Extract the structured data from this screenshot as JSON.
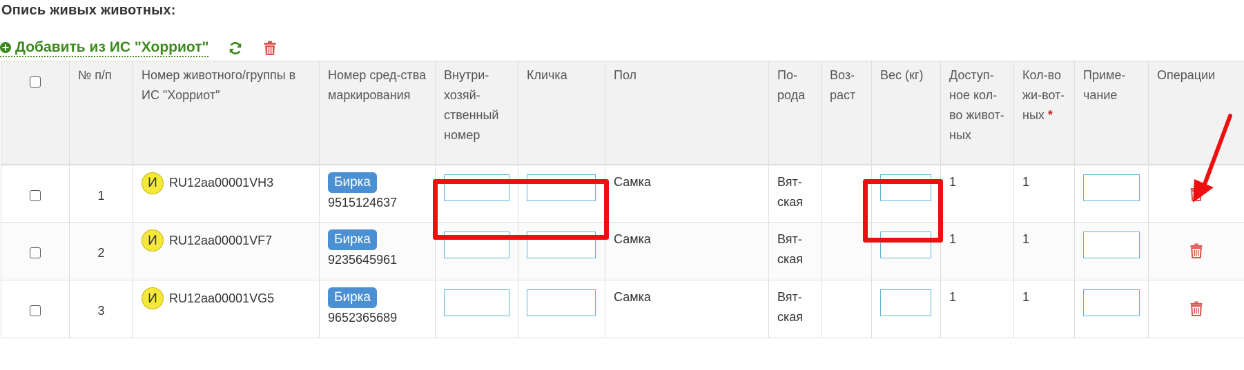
{
  "page": {
    "title": "Опись живых животных:"
  },
  "toolbar": {
    "add_label": "Добавить из ИС \"Хорриот\"",
    "refresh_icon": "refresh-icon",
    "delete_icon": "trash-icon",
    "accent_color": "#3c8a1e",
    "danger_color": "#d9534f"
  },
  "table": {
    "headers": {
      "num": "№ п/п",
      "animal_id": "Номер животного/группы в ИС \"Хорриот\"",
      "marking": "Номер сред-ства маркирования",
      "internal_num": "Внутри-хозяй-ственный номер",
      "nickname": "Кличка",
      "sex": "Пол",
      "breed": "По-рода",
      "age": "Воз-раст",
      "weight": "Вес (кг)",
      "available": "Доступ-ное кол-во живот-ных",
      "count": "Кол-во жи-вот-ных",
      "count_required": "*",
      "note": "Приме-чание",
      "ops": "Операции"
    },
    "rows": [
      {
        "num": "1",
        "badge": "И",
        "animal_id": "RU12aa00001VH3",
        "tag": "Бирка",
        "tag_number": "9515124637",
        "sex": "Самка",
        "breed": "Вят-ская",
        "available": "1",
        "count": "1"
      },
      {
        "num": "2",
        "badge": "И",
        "animal_id": "RU12aa00001VF7",
        "tag": "Бирка",
        "tag_number": "9235645961",
        "sex": "Самка",
        "breed": "Вят-ская",
        "available": "1",
        "count": "1"
      },
      {
        "num": "3",
        "badge": "И",
        "animal_id": "RU12aa00001VG5",
        "tag": "Бирка",
        "tag_number": "9652365689",
        "sex": "Самка",
        "breed": "Вят-ская",
        "available": "1",
        "count": "1"
      }
    ]
  },
  "annotation": {
    "highlight_color": "#ee1010"
  }
}
